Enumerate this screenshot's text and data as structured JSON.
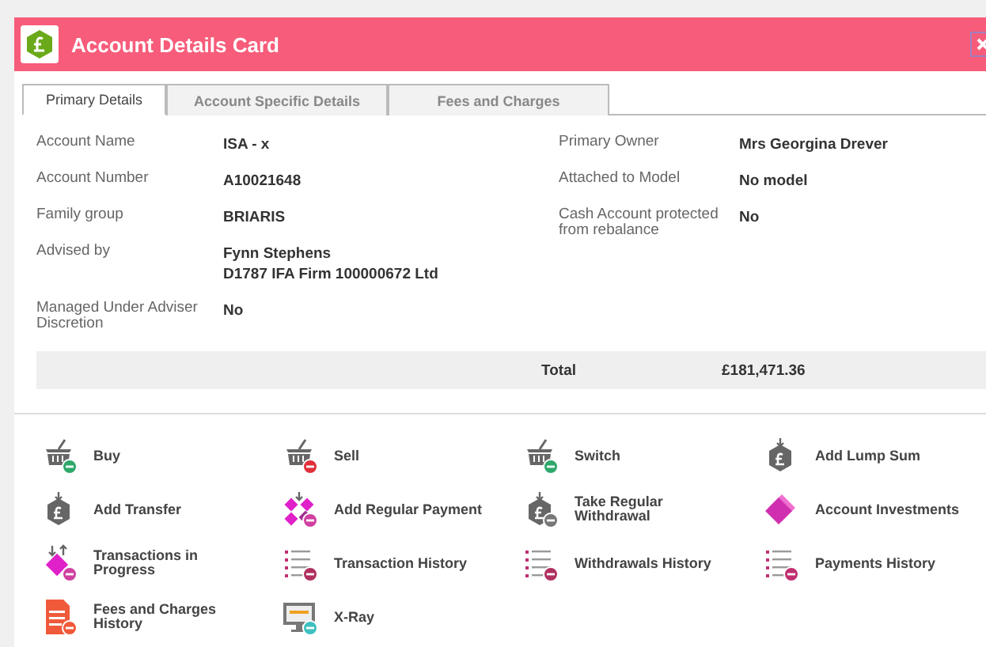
{
  "window": {
    "title": "Account Details Card"
  },
  "tabs": [
    {
      "label": "Primary Details",
      "selected": true
    },
    {
      "label": "Account Specific Details",
      "selected": false
    },
    {
      "label": "Fees and Charges",
      "selected": false
    }
  ],
  "details_left": [
    {
      "label": "Account Name",
      "value": [
        "ISA - x"
      ]
    },
    {
      "label": "Account Number",
      "value": [
        "A10021648"
      ]
    },
    {
      "label": "Family group",
      "value": [
        "BRIARIS"
      ]
    },
    {
      "label": "Advised by",
      "value": [
        "Fynn Stephens",
        "D1787 IFA Firm 100000672 Ltd"
      ]
    },
    {
      "label": "Managed Under Adviser Discretion",
      "value": [
        "No"
      ]
    }
  ],
  "details_right": [
    {
      "label": "Primary Owner",
      "value": [
        "Mrs Georgina Drever"
      ]
    },
    {
      "label": "Attached to Model",
      "value": [
        "No model"
      ]
    },
    {
      "label": "Cash Account protected from rebalance",
      "value": [
        "No"
      ]
    }
  ],
  "total": {
    "label": "Total",
    "value": "£181,471.36"
  },
  "actions": [
    {
      "label": "Buy"
    },
    {
      "label": "Sell"
    },
    {
      "label": "Switch"
    },
    {
      "label": "Add Lump Sum"
    },
    {
      "label": "Add Transfer"
    },
    {
      "label": "Add Regular Payment"
    },
    {
      "label": "Take Regular Withdrawal"
    },
    {
      "label": "Account Investments"
    },
    {
      "label": "Transactions in Progress"
    },
    {
      "label": "Transaction History"
    },
    {
      "label": "Withdrawals History"
    },
    {
      "label": "Payments History"
    },
    {
      "label": "Fees and Charges History"
    },
    {
      "label": "X-Ray"
    }
  ]
}
